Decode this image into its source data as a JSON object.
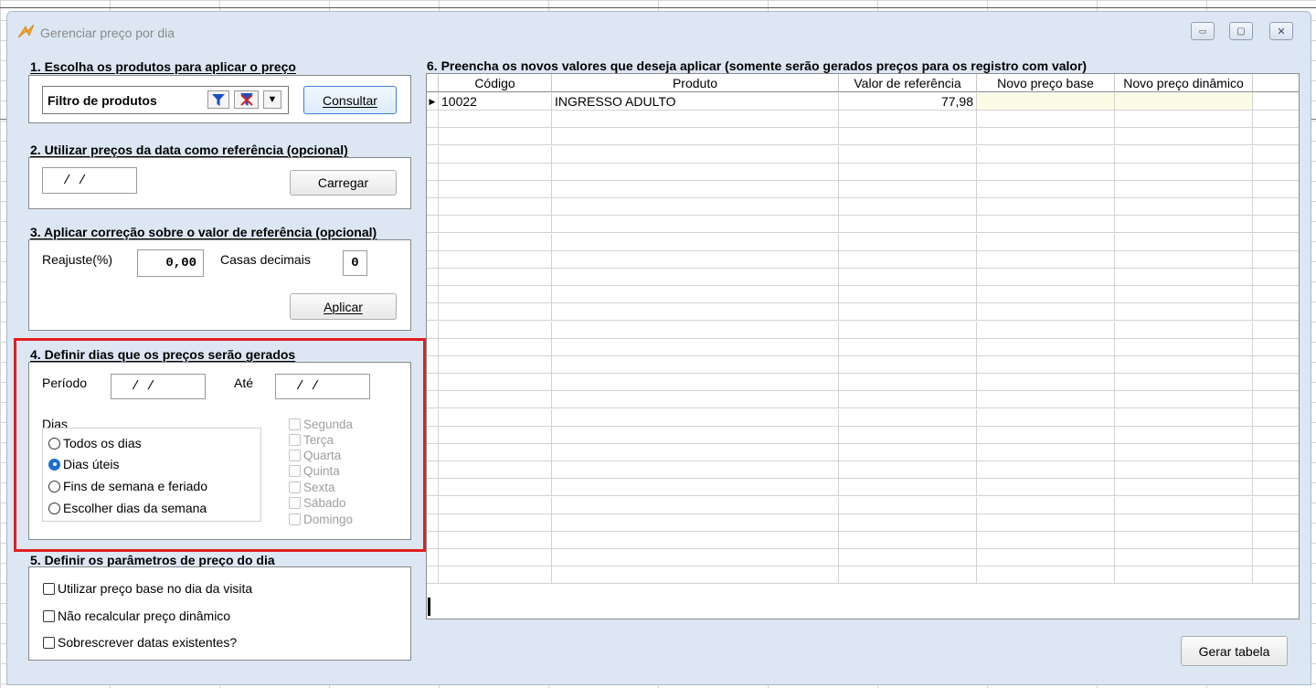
{
  "window": {
    "title": "Gerenciar preço por dia",
    "controls": {
      "minimize": "▭",
      "restore": "▢",
      "close": "✕"
    }
  },
  "section1": {
    "title": "1. Escolha os produtos para aplicar o preço",
    "filter_label": "Filtro de produtos",
    "consultar_label": "Consultar"
  },
  "section2": {
    "title": "2. Utilizar preços da data como referência (opcional)",
    "date_value": "/  /",
    "carregar_label": "Carregar"
  },
  "section3": {
    "title": "3. Aplicar correção sobre o valor de referência (opcional)",
    "reajuste_label": "Reajuste(%)",
    "reajuste_value": "0,00",
    "casas_label": "Casas decimais",
    "casas_value": "0",
    "aplicar_label": "Aplicar"
  },
  "section4": {
    "title": "4. Definir dias que os preços serão gerados",
    "periodo_label": "Período",
    "periodo_value": "/  /",
    "ate_label": "Até",
    "ate_value": "/  /",
    "dias_label": "Dias",
    "radios": [
      {
        "label": "Todos os dias",
        "selected": false
      },
      {
        "label": "Dias úteis",
        "selected": true
      },
      {
        "label": "Fins de semana e feriado",
        "selected": false
      },
      {
        "label": "Escolher dias da semana",
        "selected": false
      }
    ],
    "weekdays": [
      "Segunda",
      "Terça",
      "Quarta",
      "Quinta",
      "Sexta",
      "Sábado",
      "Domingo"
    ]
  },
  "section5": {
    "title": "5. Definir os parâmetros de preço do dia",
    "checks": [
      {
        "label": "Utilizar preço base no dia da visita",
        "checked": false
      },
      {
        "label": "Não recalcular preço dinâmico",
        "checked": false
      },
      {
        "label": "Sobrescrever datas existentes?",
        "checked": false
      }
    ]
  },
  "section6": {
    "title": "6. Preencha os novos valores que deseja aplicar (somente serão gerados preços para os registro com valor)",
    "columns": [
      "Código",
      "Produto",
      "Valor de referência",
      "Novo preço base",
      "Novo preço dinâmico"
    ],
    "rows": [
      {
        "codigo": "10022",
        "produto": "INGRESSO ADULTO",
        "valor_referencia": "77,98",
        "novo_preco_base": "",
        "novo_preco_dinamico": ""
      }
    ]
  },
  "gerar_tabela_label": "Gerar tabela",
  "colors": {
    "window_bg": "#dce7f3",
    "highlight": "#e02020",
    "accent": "#1a6fd1"
  }
}
